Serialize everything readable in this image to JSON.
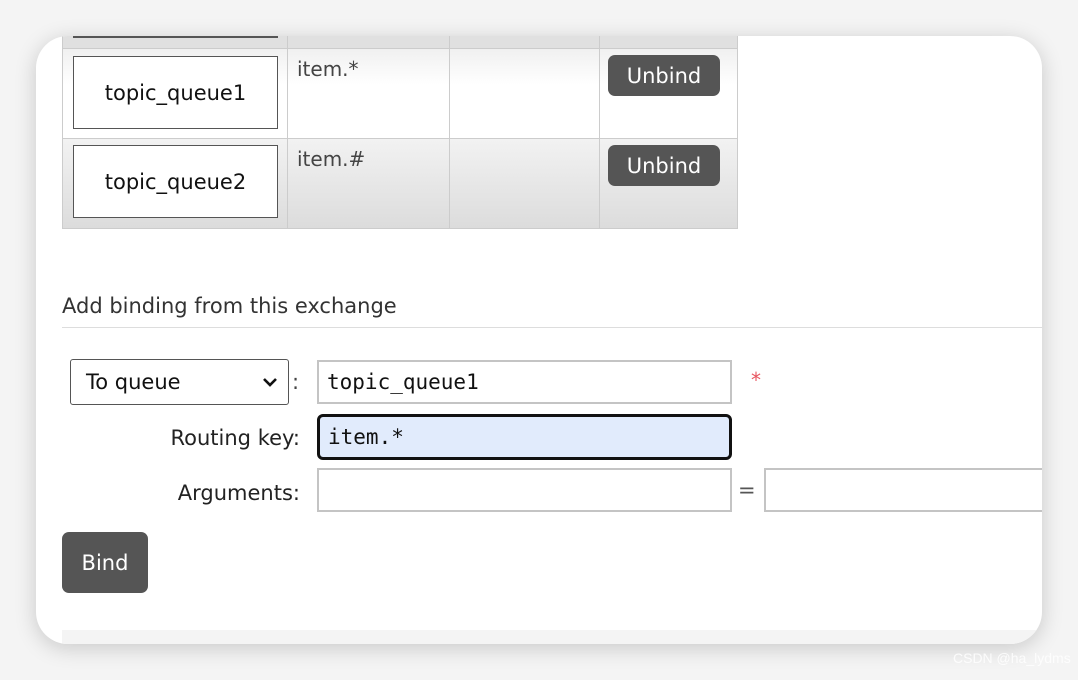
{
  "bindings": {
    "rows": [
      {
        "destination": "topic_queue1",
        "routing_key": "item.*",
        "arguments": "",
        "action": "Unbind"
      },
      {
        "destination": "topic_queue2",
        "routing_key": "item.#",
        "arguments": "",
        "action": "Unbind"
      }
    ]
  },
  "add_binding": {
    "heading": "Add binding from this exchange",
    "destination_type": "To queue",
    "colon": ":",
    "destination_value": "topic_queue1",
    "required_marker": "*",
    "routing_key_label": "Routing key:",
    "routing_key_value": "item.*",
    "arguments_label": "Arguments:",
    "arguments_key": "",
    "equals": "=",
    "arguments_value": "",
    "bind_label": "Bind"
  },
  "watermark": "CSDN @ha_lydms",
  "colors": {
    "button": "#555555",
    "focus_bg": "#e1ebfc",
    "required": "#e8555f"
  }
}
